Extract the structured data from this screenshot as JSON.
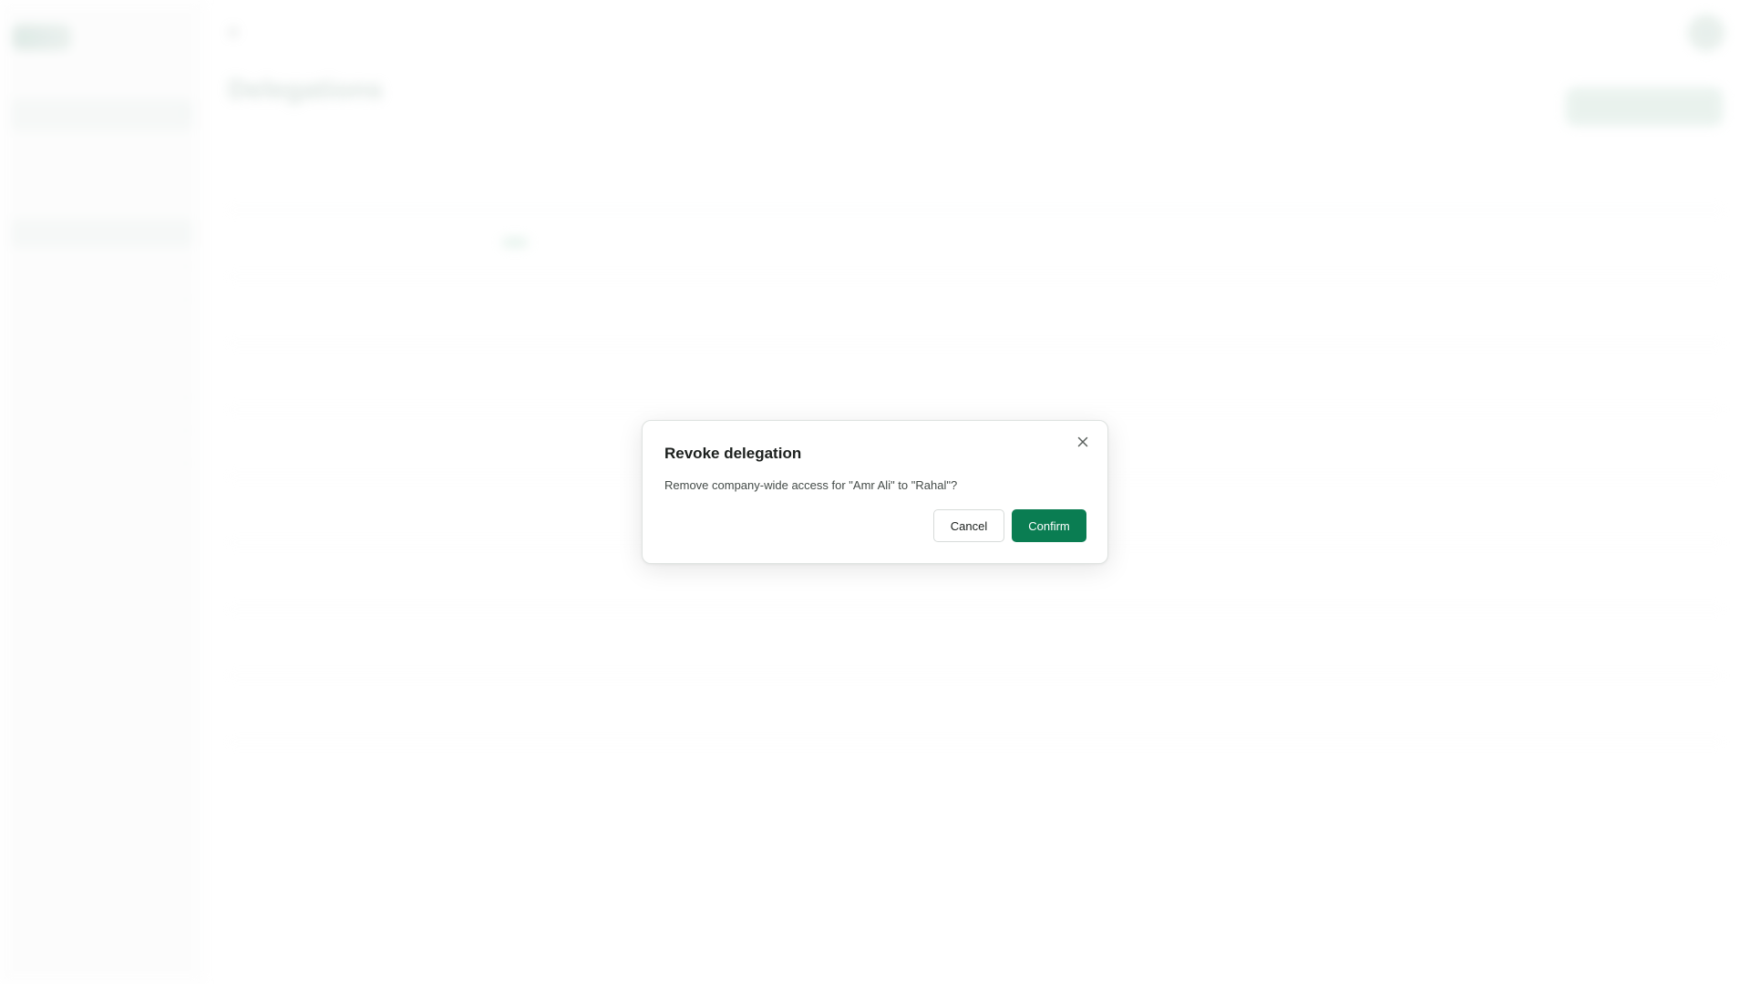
{
  "background": {
    "sidebar": {
      "items": [
        {
          "label": ""
        },
        {
          "label": ""
        },
        {
          "label": ""
        },
        {
          "label": ""
        },
        {
          "label": ""
        },
        {
          "label": ""
        },
        {
          "label": ""
        },
        {
          "label": ""
        },
        {
          "label": ""
        },
        {
          "label": ""
        },
        {
          "label": ""
        },
        {
          "label": ""
        },
        {
          "label": ""
        }
      ]
    },
    "page": {
      "title": "Delegations",
      "subtitle": ""
    },
    "table_rows": 8
  },
  "modal": {
    "title": "Revoke delegation",
    "message": "Remove company-wide access for \"Amr Ali\" to \"Rahal\"?",
    "cancel_label": "Cancel",
    "confirm_label": "Confirm",
    "close_icon": "close-icon"
  },
  "colors": {
    "accent": "#0a7d52"
  }
}
